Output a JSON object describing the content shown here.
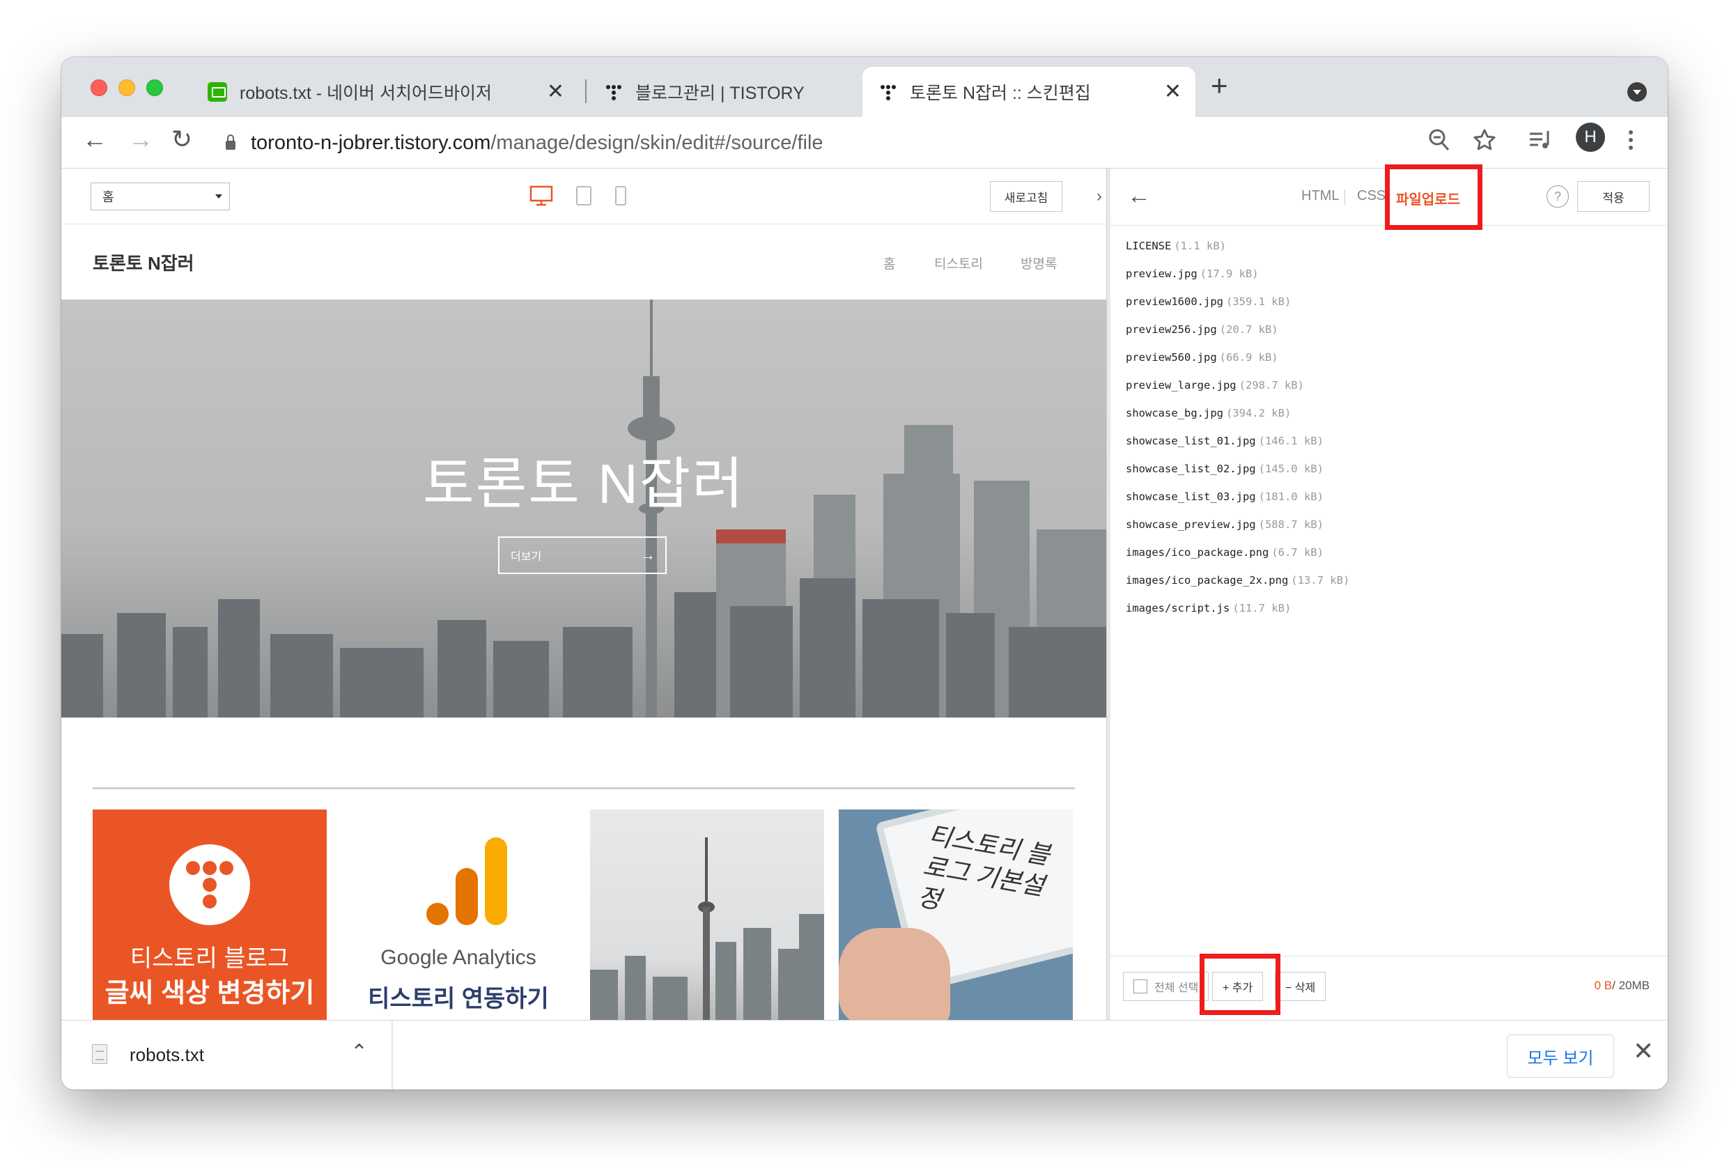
{
  "browser": {
    "tabs": [
      {
        "title": "robots.txt - 네이버 서치어드바이저",
        "favicon": "naver-search-advisor-icon"
      },
      {
        "title": "블로그관리 | TISTORY",
        "favicon": "tistory-icon"
      },
      {
        "title": "토론토 N잡러 :: 스킨편집",
        "favicon": "tistory-icon",
        "active": true
      }
    ],
    "new_tab_symbol": "+",
    "close_symbol": "✕",
    "url_host": "toronto-n-jobrer.tistory.com",
    "url_path": "/manage/design/skin/edit#/source/file",
    "avatar_initial": "H"
  },
  "preview": {
    "page_select_value": "홈",
    "refresh_label": "새로고침",
    "blog_title": "토론토 N잡러",
    "nav": [
      "홈",
      "티스토리",
      "방명록"
    ],
    "hero_title": "토론토 N잡러",
    "hero_button": "더보기",
    "thumbnails": [
      {
        "line1": "티스토리 블로그",
        "line2": "글씨 색상 변경하기"
      },
      {
        "line1": "Google Analytics",
        "line2": "티스토리 연동하기"
      },
      {},
      {
        "text": "티스토리 블로그 기본설정"
      }
    ]
  },
  "editor": {
    "tabs": [
      "HTML",
      "CSS",
      "파일업로드"
    ],
    "selected_tab": "파일업로드",
    "apply_label": "적용",
    "help_symbol": "?",
    "files": [
      {
        "name": "LICENSE",
        "size": "(1.1 kB)"
      },
      {
        "name": "preview.jpg",
        "size": "(17.9 kB)"
      },
      {
        "name": "preview1600.jpg",
        "size": "(359.1 kB)"
      },
      {
        "name": "preview256.jpg",
        "size": "(20.7 kB)"
      },
      {
        "name": "preview560.jpg",
        "size": "(66.9 kB)"
      },
      {
        "name": "preview_large.jpg",
        "size": "(298.7 kB)"
      },
      {
        "name": "showcase_bg.jpg",
        "size": "(394.2 kB)"
      },
      {
        "name": "showcase_list_01.jpg",
        "size": "(146.1 kB)"
      },
      {
        "name": "showcase_list_02.jpg",
        "size": "(145.0 kB)"
      },
      {
        "name": "showcase_list_03.jpg",
        "size": "(181.0 kB)"
      },
      {
        "name": "showcase_preview.jpg",
        "size": "(588.7 kB)"
      },
      {
        "name": "images/ico_package.png",
        "size": "(6.7 kB)"
      },
      {
        "name": "images/ico_package_2x.png",
        "size": "(13.7 kB)"
      },
      {
        "name": "images/script.js",
        "size": "(11.7 kB)"
      }
    ],
    "select_all_label": "전체 선택",
    "add_label": "+ 추가",
    "delete_label": "− 삭제",
    "quota_used": "0 B",
    "quota_total": "/ 20MB",
    "highlight_color": "#ee1c1c",
    "accent_color": "#ea5525"
  },
  "downloads": {
    "file_name": "robots.txt",
    "show_all_label": "모두 보기",
    "close_symbol": "✕"
  }
}
